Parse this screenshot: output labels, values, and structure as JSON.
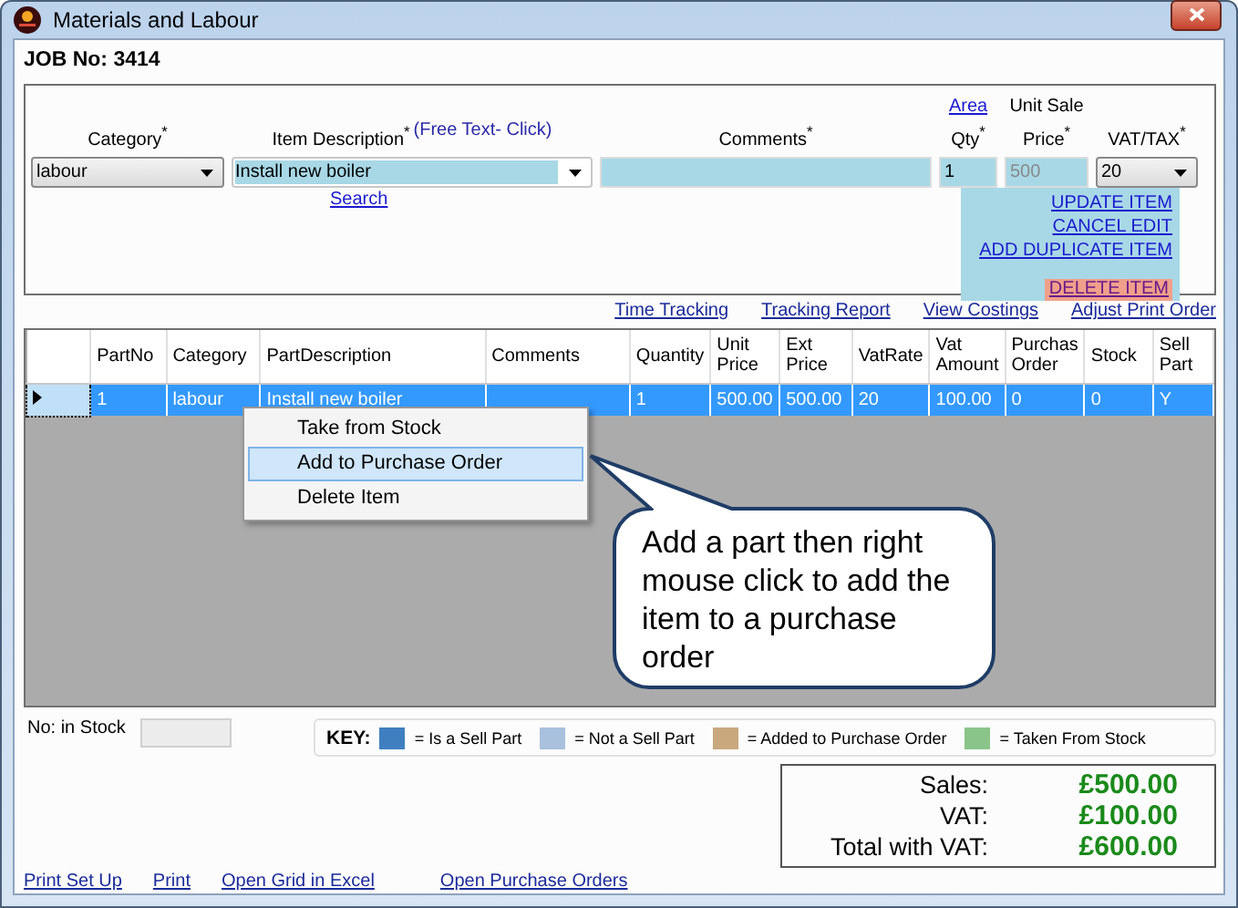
{
  "window": {
    "title": "Materials and Labour"
  },
  "job_no": "JOB No: 3414",
  "form": {
    "category": {
      "label": "Category$^{*}$",
      "value": "labour"
    },
    "description": {
      "label": "Item Description$^{*}$",
      "link": "(Free Text- Click)",
      "value": "Install new boiler",
      "search": "Search"
    },
    "comments": {
      "label": "Comments$^{*}$"
    },
    "qty": {
      "link": "Area",
      "label": "Qty$^{*}$",
      "value": "1"
    },
    "unit_price": {
      "label": "Unit Sale",
      "label2": "Price$^{*}$",
      "value": "500",
      "disabled": true
    },
    "vat": {
      "label": "VAT/TAX$^{*}$",
      "value": "20"
    },
    "actions": [
      {
        "label": "UPDATE ITEM",
        "highlighted": false
      },
      {
        "label": "CANCEL EDIT",
        "highlighted": false
      },
      {
        "label": "ADD DUPLICATE ITEM",
        "highlighted": false
      },
      {
        "label": "DELETE ITEM",
        "highlighted": true
      }
    ]
  },
  "links": [
    "Time Tracking",
    "Tracking Report",
    "View Costings",
    "Adjust Print Order"
  ],
  "grid": {
    "columns": [
      "PartNo",
      "Category",
      "PartDescription",
      "Comments",
      "Quantity",
      "Unit Price",
      "Ext Price",
      "VatRate",
      "Vat Amount",
      "Purchas Order",
      "Stock",
      "Sell Part"
    ],
    "rows": [
      {
        "selected": true,
        "cells": [
          "1",
          "labour",
          "Install new boiler",
          "",
          "1",
          "500.00",
          "500.00",
          "20",
          "100.00",
          "0",
          "0",
          "Y"
        ]
      }
    ]
  },
  "context_menu": [
    {
      "label": "Take from Stock",
      "selected": false
    },
    {
      "label": "Add to Purchase Order",
      "selected": true
    },
    {
      "label": "Delete Item",
      "selected": false
    }
  ],
  "callout": "Add a part then right mouse click to add the item to a purchase order",
  "stock": {
    "label": "No: in Stock"
  },
  "key": {
    "label": "KEY:",
    "items": [
      {
        "label": "= Is a  Sell Part",
        "color": "#3f7fbf"
      },
      {
        "label": "= Not a Sell Part",
        "color": "#a9c1dd"
      },
      {
        "label": "= Added to Purchase Order",
        "color": "#c9a87e"
      },
      {
        "label": "= Taken From Stock",
        "color": "#8ac48a"
      }
    ]
  },
  "totals": [
    {
      "label": "Sales:",
      "value": "£500.00"
    },
    {
      "label": "VAT:",
      "value": "£100.00"
    },
    {
      "label": "Total with VAT:",
      "value": "£600.00"
    }
  ],
  "footer_links": [
    "Print Set Up",
    "Print",
    "Open Grid in Excel",
    "Open Purchase Orders"
  ]
}
